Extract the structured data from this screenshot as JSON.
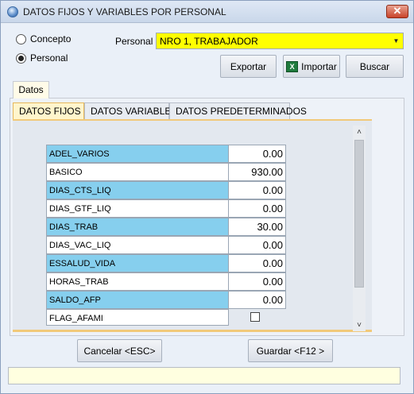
{
  "window": {
    "title": "DATOS FIJOS Y VARIABLES POR PERSONAL",
    "close_label": "✕"
  },
  "radios": {
    "concepto": {
      "label": "Concepto",
      "selected": false
    },
    "personal": {
      "label": "Personal",
      "selected": true
    }
  },
  "personal_field": {
    "label": "Personal",
    "value": "NRO 1, TRABAJADOR",
    "arrow": "▼"
  },
  "toolbar": {
    "exportar": "Exportar",
    "importar": "Importar",
    "importar_icon": "X",
    "buscar": "Buscar"
  },
  "outer_tabs": [
    "Datos"
  ],
  "inner_tabs": [
    "DATOS  FIJOS",
    "DATOS VARIABLES",
    "DATOS PREDETERMINADOS"
  ],
  "grid_rows": [
    {
      "name": "ADEL_VARIOS",
      "value": "0.00"
    },
    {
      "name": "BASICO",
      "value": "930.00"
    },
    {
      "name": "DIAS_CTS_LIQ",
      "value": "0.00"
    },
    {
      "name": "DIAS_GTF_LIQ",
      "value": "0.00"
    },
    {
      "name": "DIAS_TRAB",
      "value": "30.00"
    },
    {
      "name": "DIAS_VAC_LIQ",
      "value": "0.00"
    },
    {
      "name": "ESSALUD_VIDA",
      "value": "0.00"
    },
    {
      "name": "HORAS_TRAB",
      "value": "0.00"
    },
    {
      "name": "SALDO_AFP",
      "value": "0.00"
    },
    {
      "name": "FLAG_AFAMI",
      "value": ""
    }
  ],
  "scroll": {
    "up": "˄",
    "down": "˅"
  },
  "footer": {
    "cancelar": "Cancelar <ESC>",
    "guardar": "Guardar <F12 >"
  },
  "colors": {
    "highlight": "#ffff00",
    "row_alt": "#86cfee",
    "tab_active": "#fff5cc"
  }
}
